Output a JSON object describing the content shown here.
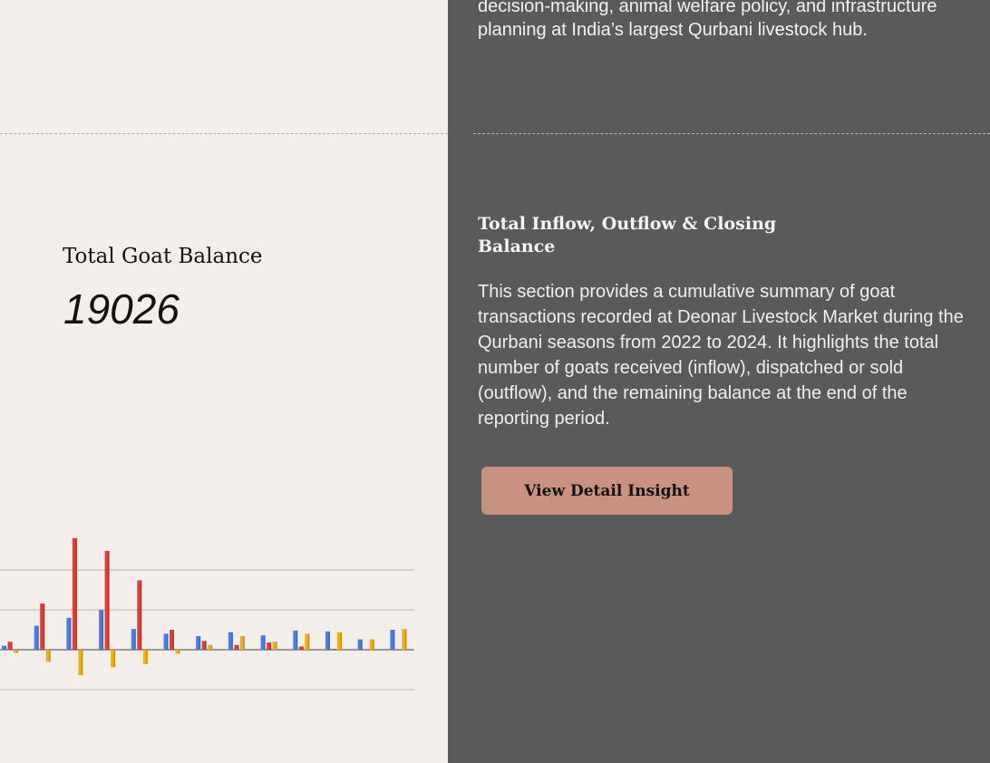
{
  "intro": {
    "text": "decision-making, animal welfare policy, and infrastructure planning at India’s largest Qurbani livestock hub."
  },
  "stat": {
    "label": "Total Goat Balance",
    "value": "19026"
  },
  "section": {
    "title": "Total Inflow, Outflow & Closing Balance",
    "body": "This section provides a cumulative summary of goat transactions recorded at Deonar Livestock Market during the Qurbani seasons from 2022 to 2024. It highlights the total number of goats received (inflow), dispatched or sold (outflow), and the remaining balance at the end of the reporting period.",
    "button_label": "View Detail Insight"
  },
  "colors": {
    "inflow": "#4a7fe0",
    "outflow": "#d9413a",
    "balance": "#eab01e",
    "left_bg": "#f3eee9",
    "right_bg": "#5a5a5a",
    "button_bg": "#c99180"
  },
  "chart_data": {
    "type": "bar",
    "grid": true,
    "series": [
      {
        "values": [
          0.5,
          3.0,
          4.0,
          5.0,
          2.6,
          2.0,
          1.7,
          2.2,
          1.8,
          2.4,
          2.3,
          1.3,
          2.5
        ]
      },
      {
        "values": [
          1.0,
          5.8,
          14.0,
          12.4,
          8.7,
          2.5,
          1.1,
          0.6,
          0.9,
          0.4,
          0.1,
          0.0,
          0.0
        ]
      },
      {
        "values": [
          -0.4,
          -1.5,
          -3.2,
          -2.2,
          -1.8,
          -0.5,
          0.6,
          1.7,
          1.0,
          2.0,
          2.2,
          1.3,
          2.6
        ]
      }
    ],
    "ylim": [
      -5,
      10
    ]
  }
}
